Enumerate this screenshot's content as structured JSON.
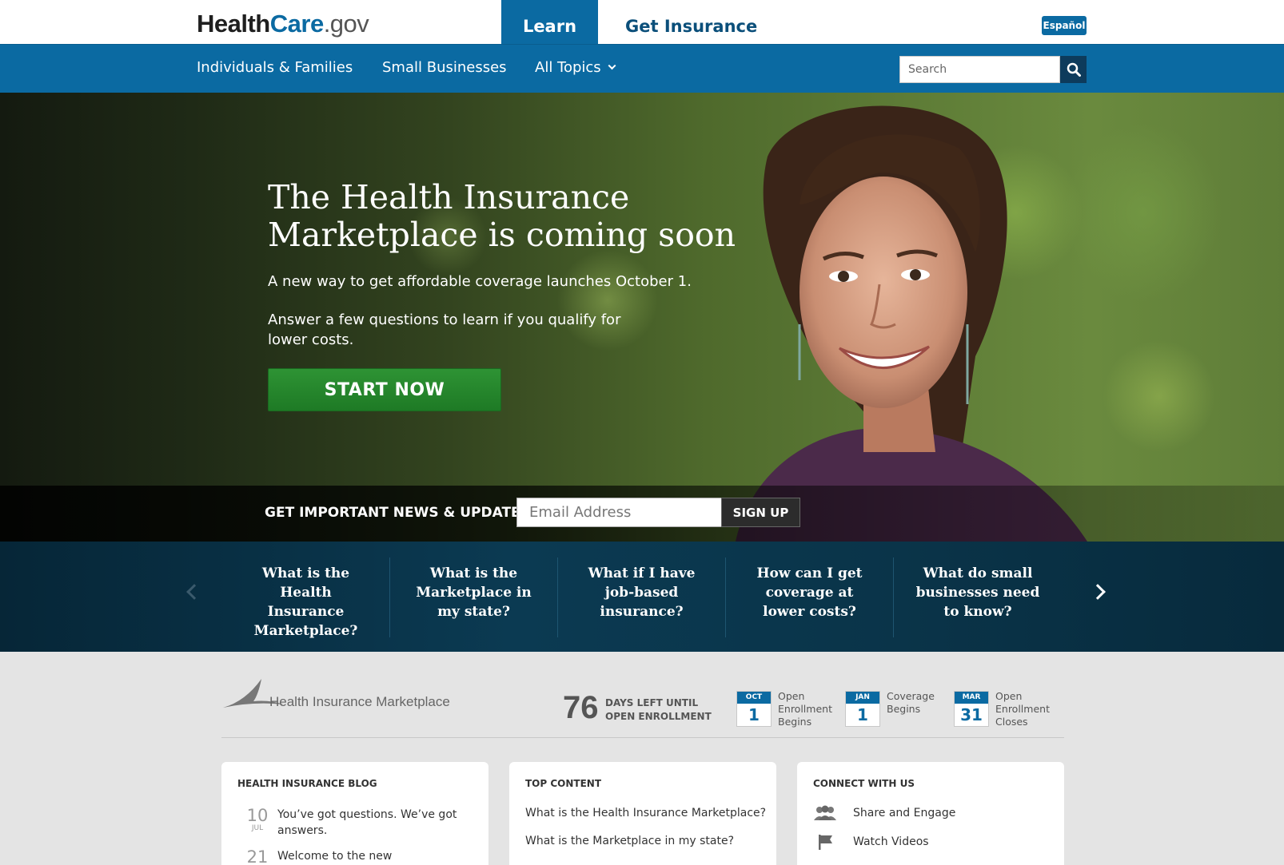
{
  "header": {
    "logo_health": "Health",
    "logo_care": "Care",
    "logo_gov": ".gov",
    "tab_learn": "Learn",
    "tab_get_insurance": "Get Insurance",
    "espanol": "Español"
  },
  "nav": {
    "items": [
      "Individuals & Families",
      "Small Businesses",
      "All Topics"
    ],
    "search_placeholder": "Search"
  },
  "hero": {
    "title": "The Health Insurance Marketplace is coming soon",
    "subtitle": "A new way to get affordable coverage launches October 1.",
    "body": "Answer a few questions to learn if you qualify for lower costs.",
    "cta": "START NOW"
  },
  "newsletter": {
    "label": "GET IMPORTANT NEWS & UPDATES",
    "email_placeholder": "Email Address",
    "button": "SIGN UP"
  },
  "carousel": {
    "items": [
      "What is the Health Insurance Marketplace?",
      "What is the Marketplace in my state?",
      "What if I have job-based insurance?",
      "How can I get coverage at lower costs?",
      "What do small businesses need to know?"
    ]
  },
  "info": {
    "logo_text": "Health Insurance Marketplace",
    "days_left": "76",
    "days_line1": "DAYS LEFT UNTIL",
    "days_line2": "OPEN ENROLLMENT",
    "dates": [
      {
        "month": "OCT",
        "day": "1",
        "text": "Open Enrollment Begins"
      },
      {
        "month": "JAN",
        "day": "1",
        "text": "Coverage Begins"
      },
      {
        "month": "MAR",
        "day": "31",
        "text": "Open Enrollment Closes"
      }
    ]
  },
  "blog": {
    "heading": "HEALTH INSURANCE BLOG",
    "entries": [
      {
        "day": "10",
        "month": "JUL",
        "title": "You’ve got questions. We’ve got answers."
      },
      {
        "day": "21",
        "month": "",
        "title": "Welcome to the new"
      }
    ]
  },
  "top_content": {
    "heading": "TOP CONTENT",
    "links": [
      "What is the Health Insurance Marketplace?",
      "What is the Marketplace in my state?"
    ]
  },
  "connect": {
    "heading": "CONNECT WITH US",
    "items": [
      {
        "icon": "people-icon",
        "label": "Share and Engage"
      },
      {
        "icon": "flag-icon",
        "label": "Watch Videos"
      }
    ]
  }
}
